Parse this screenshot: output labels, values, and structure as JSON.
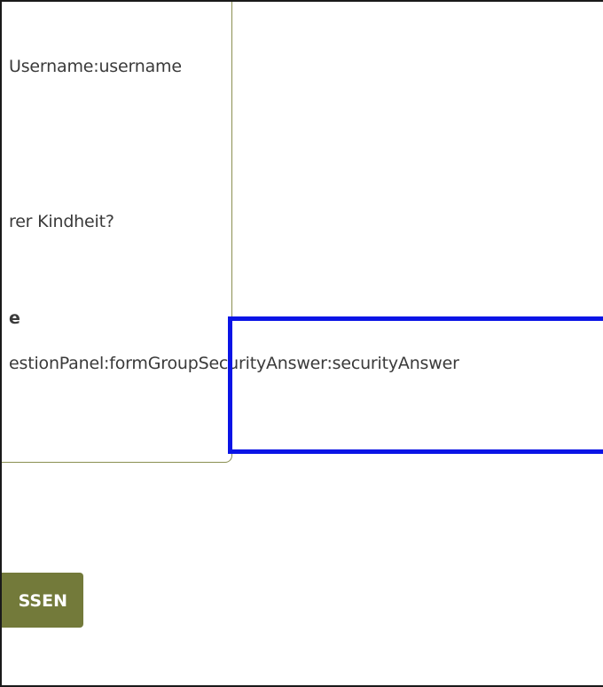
{
  "form": {
    "username_label": "Username:username",
    "security_question_text": "rer Kindheit?",
    "security_answer_heading": "e",
    "security_answer_value": "estionPanel:formGroupSecurityAnswer:securityAnswer",
    "submit_label": "SSEN"
  },
  "colors": {
    "panel_border": "#8a8f52",
    "button_bg": "#737a3a",
    "highlight": "#0a14e6"
  }
}
